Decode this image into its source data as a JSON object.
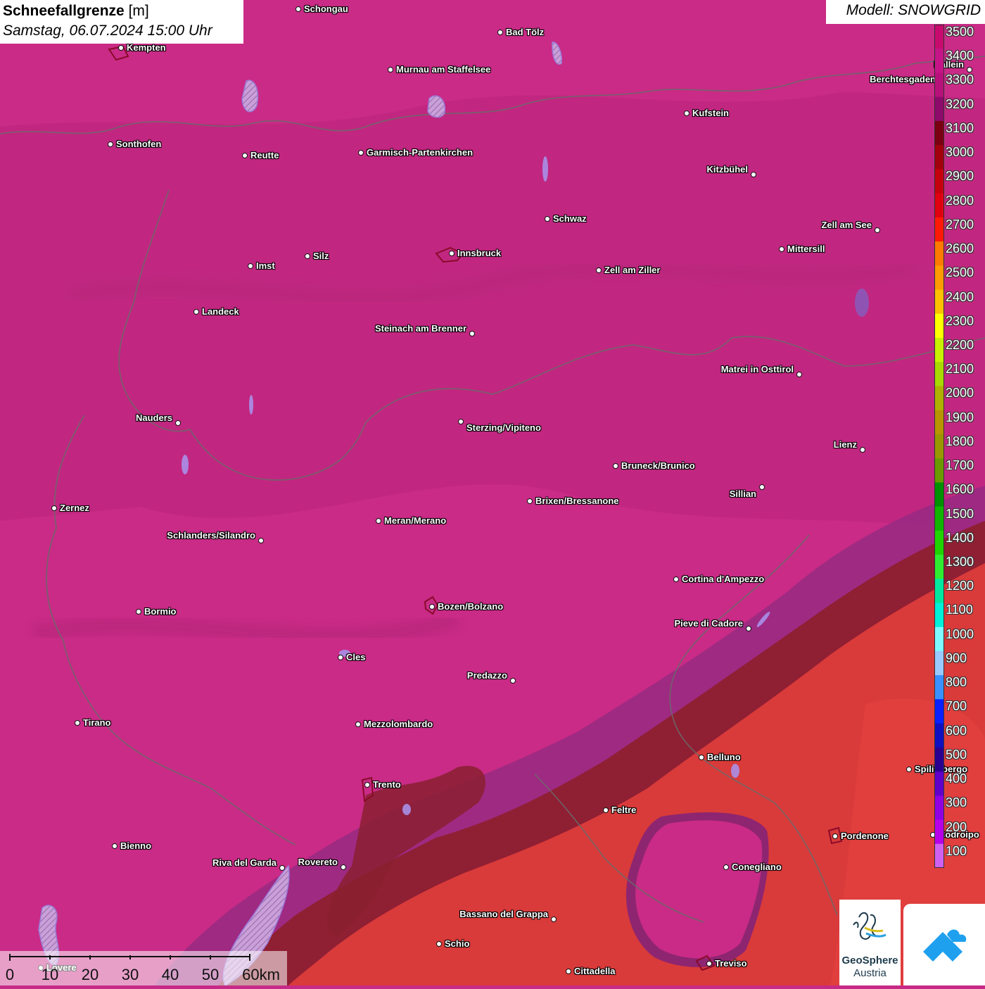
{
  "header": {
    "title_bold": "Schneefallgrenze",
    "title_unit": "[m]",
    "datetime": "Samstag, 06.07.2024 15:00 Uhr"
  },
  "model": {
    "label": "Modell: SNOWGRID"
  },
  "legend": {
    "labels": [
      "3500",
      "3400",
      "3300",
      "3200",
      "3100",
      "3000",
      "2900",
      "2800",
      "2700",
      "2600",
      "2500",
      "2400",
      "2300",
      "2200",
      "2100",
      "2000",
      "1900",
      "1800",
      "1700",
      "1600",
      "1500",
      "1400",
      "1300",
      "1200",
      "1100",
      "1000",
      "900",
      "800",
      "700",
      "600",
      "500",
      "400",
      "300",
      "200",
      "100"
    ],
    "colors": [
      "#c80a6e",
      "#c41488",
      "#b8107a",
      "#8c0a6a",
      "#7a0012",
      "#a3000e",
      "#c4000c",
      "#e00010",
      "#ff1a08",
      "#ff7a00",
      "#ff9a00",
      "#ffc000",
      "#ffff00",
      "#c8f000",
      "#a8d800",
      "#b0b000",
      "#b89400",
      "#9a9600",
      "#6a9a00",
      "#009000",
      "#10b400",
      "#20d400",
      "#30ec30",
      "#00e8a0",
      "#00f0d8",
      "#80f8ff",
      "#9ac8ff",
      "#3a90ff",
      "#0a20ff",
      "#1010c0",
      "#2a0090",
      "#6000c8",
      "#9000e0",
      "#b800e8",
      "#d060f0"
    ]
  },
  "cities": [
    {
      "name": "Schongau"
    },
    {
      "name": "Bad Tölz"
    },
    {
      "name": "Kempten"
    },
    {
      "name": "Murnau am Staffelsee"
    },
    {
      "name": "Berchtesgaden"
    },
    {
      "name": "Hallein"
    },
    {
      "name": "Kufstein"
    },
    {
      "name": "Sonthofen"
    },
    {
      "name": "Reutte"
    },
    {
      "name": "Garmisch-Partenkirchen"
    },
    {
      "name": "Kitzbühel"
    },
    {
      "name": "Schwaz"
    },
    {
      "name": "Zell am See"
    },
    {
      "name": "Innsbruck"
    },
    {
      "name": "Mittersill"
    },
    {
      "name": "Imst"
    },
    {
      "name": "Silz"
    },
    {
      "name": "Zell am Ziller"
    },
    {
      "name": "Landeck"
    },
    {
      "name": "Steinach am Brenner"
    },
    {
      "name": "Matrei in Osttirol"
    },
    {
      "name": "Nauders"
    },
    {
      "name": "Sterzing/Vipiteno"
    },
    {
      "name": "Lienz"
    },
    {
      "name": "Bruneck/Brunico"
    },
    {
      "name": "Sillian"
    },
    {
      "name": "Zernez"
    },
    {
      "name": "Brixen/Bressanone"
    },
    {
      "name": "Meran/Merano"
    },
    {
      "name": "Schlanders/Silandro"
    },
    {
      "name": "Cortina d'Ampezzo"
    },
    {
      "name": "Bozen/Bolzano"
    },
    {
      "name": "Bormio"
    },
    {
      "name": "Pieve di Cadore"
    },
    {
      "name": "Cles"
    },
    {
      "name": "Predazzo"
    },
    {
      "name": "Tirano"
    },
    {
      "name": "Mezzolombardo"
    },
    {
      "name": "Belluno"
    },
    {
      "name": "Spilimbergo"
    },
    {
      "name": "Trento"
    },
    {
      "name": "Feltre"
    },
    {
      "name": "Pordenone"
    },
    {
      "name": "Codroipo"
    },
    {
      "name": "Bienno"
    },
    {
      "name": "Riva del Garda"
    },
    {
      "name": "Rovereto"
    },
    {
      "name": "Conegliano"
    },
    {
      "name": "Bassano del Grappa"
    },
    {
      "name": "Schio"
    },
    {
      "name": "Treviso"
    },
    {
      "name": "Cittadella"
    },
    {
      "name": "Lovere"
    }
  ],
  "scalebar": {
    "labels": [
      "0",
      "10",
      "20",
      "30",
      "40",
      "50",
      "60km"
    ]
  },
  "logos": {
    "geosphere_name": "GeoSphere",
    "geosphere_sub": "Austria"
  }
}
